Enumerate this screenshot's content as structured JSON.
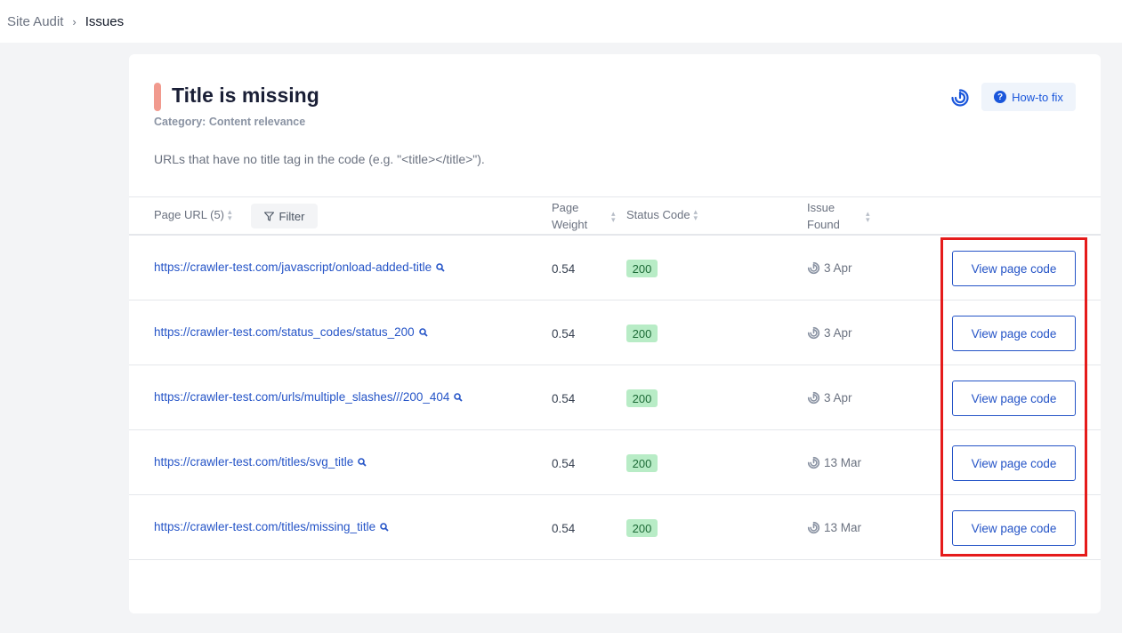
{
  "breadcrumb": {
    "root": "Site Audit",
    "separator": "›",
    "current": "Issues"
  },
  "issue": {
    "title": "Title is missing",
    "category": "Category: Content relevance",
    "description": "URLs that have no title tag in the code (e.g. \"<title></title>\").",
    "accent_color": "#f19a8e"
  },
  "actions": {
    "how_to_fix": "How-to fix",
    "question_icon": "?"
  },
  "table": {
    "headers": {
      "page_url": "Page URL (5)",
      "filter": "Filter",
      "page_weight_line1": "Page",
      "page_weight_line2": "Weight",
      "status_code": "Status Code",
      "issue_found_line1": "Issue",
      "issue_found_line2": "Found"
    },
    "rows": [
      {
        "url": "https://crawler-test.com/javascript/onload-added-title",
        "weight": "0.54",
        "status": "200",
        "found": "3 Apr",
        "action": "View page code"
      },
      {
        "url": "https://crawler-test.com/status_codes/status_200",
        "weight": "0.54",
        "status": "200",
        "found": "3 Apr",
        "action": "View page code"
      },
      {
        "url": "https://crawler-test.com/urls/multiple_slashes///200_404",
        "weight": "0.54",
        "status": "200",
        "found": "3 Apr",
        "action": "View page code"
      },
      {
        "url": "https://crawler-test.com/titles/svg_title",
        "weight": "0.54",
        "status": "200",
        "found": "13 Mar",
        "action": "View page code"
      },
      {
        "url": "https://crawler-test.com/titles/missing_title",
        "weight": "0.54",
        "status": "200",
        "found": "13 Mar",
        "action": "View page code"
      }
    ]
  },
  "colors": {
    "link": "#2554c7",
    "status_bg": "#b8ecc6",
    "highlight": "#e51b1b"
  }
}
